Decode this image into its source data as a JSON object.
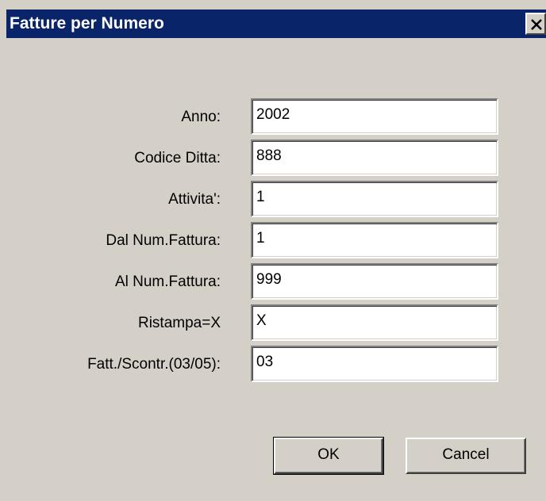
{
  "window": {
    "title": "Fatture per Numero",
    "close_label": "✕"
  },
  "form": {
    "fields": [
      {
        "label": "Anno:",
        "value": "2002"
      },
      {
        "label": "Codice Ditta:",
        "value": "888"
      },
      {
        "label": "Attivita':",
        "value": "1"
      },
      {
        "label": "Dal Num.Fattura:",
        "value": "1"
      },
      {
        "label": "Al Num.Fattura:",
        "value": "999"
      },
      {
        "label": "Ristampa=X",
        "value": "X"
      },
      {
        "label": "Fatt./Scontr.(03/05):",
        "value": "03"
      }
    ]
  },
  "buttons": {
    "ok_label": "OK",
    "cancel_label": "Cancel"
  },
  "colors": {
    "title_bar": "#0a246a",
    "face": "#d4d0c8",
    "title_text": "#ffffff"
  }
}
